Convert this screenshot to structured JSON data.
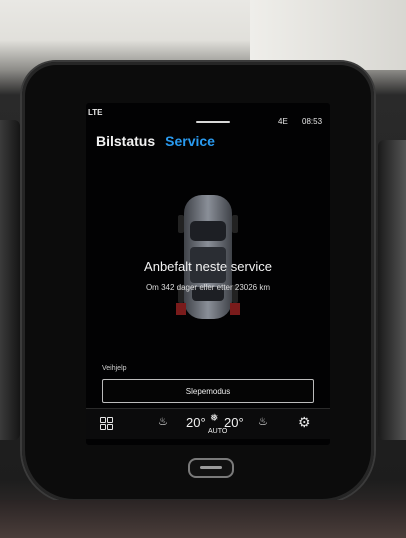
{
  "status_bar": {
    "left_indicator": "LTE",
    "right_indicators": "4E",
    "time": "08:53"
  },
  "tabs": [
    {
      "label": "Bilstatus",
      "active": false
    },
    {
      "label": "Service",
      "active": true
    }
  ],
  "service": {
    "headline": "Anbefalt neste service",
    "detail": "Om 342 dager eller etter 23026 km"
  },
  "roadside": {
    "label": "Veihjelp",
    "tow_button": "Slepemodus"
  },
  "climate": {
    "left_temp": "20°",
    "fan_mode": "AUTO",
    "right_temp": "20°"
  },
  "colors": {
    "accent": "#2a9bf0",
    "screen_bg": "#020203"
  },
  "icons": [
    "home-grid-icon",
    "seat-heat-left-icon",
    "fan-icon",
    "seat-heat-right-icon",
    "settings-gear-icon",
    "car-topview-icon"
  ]
}
